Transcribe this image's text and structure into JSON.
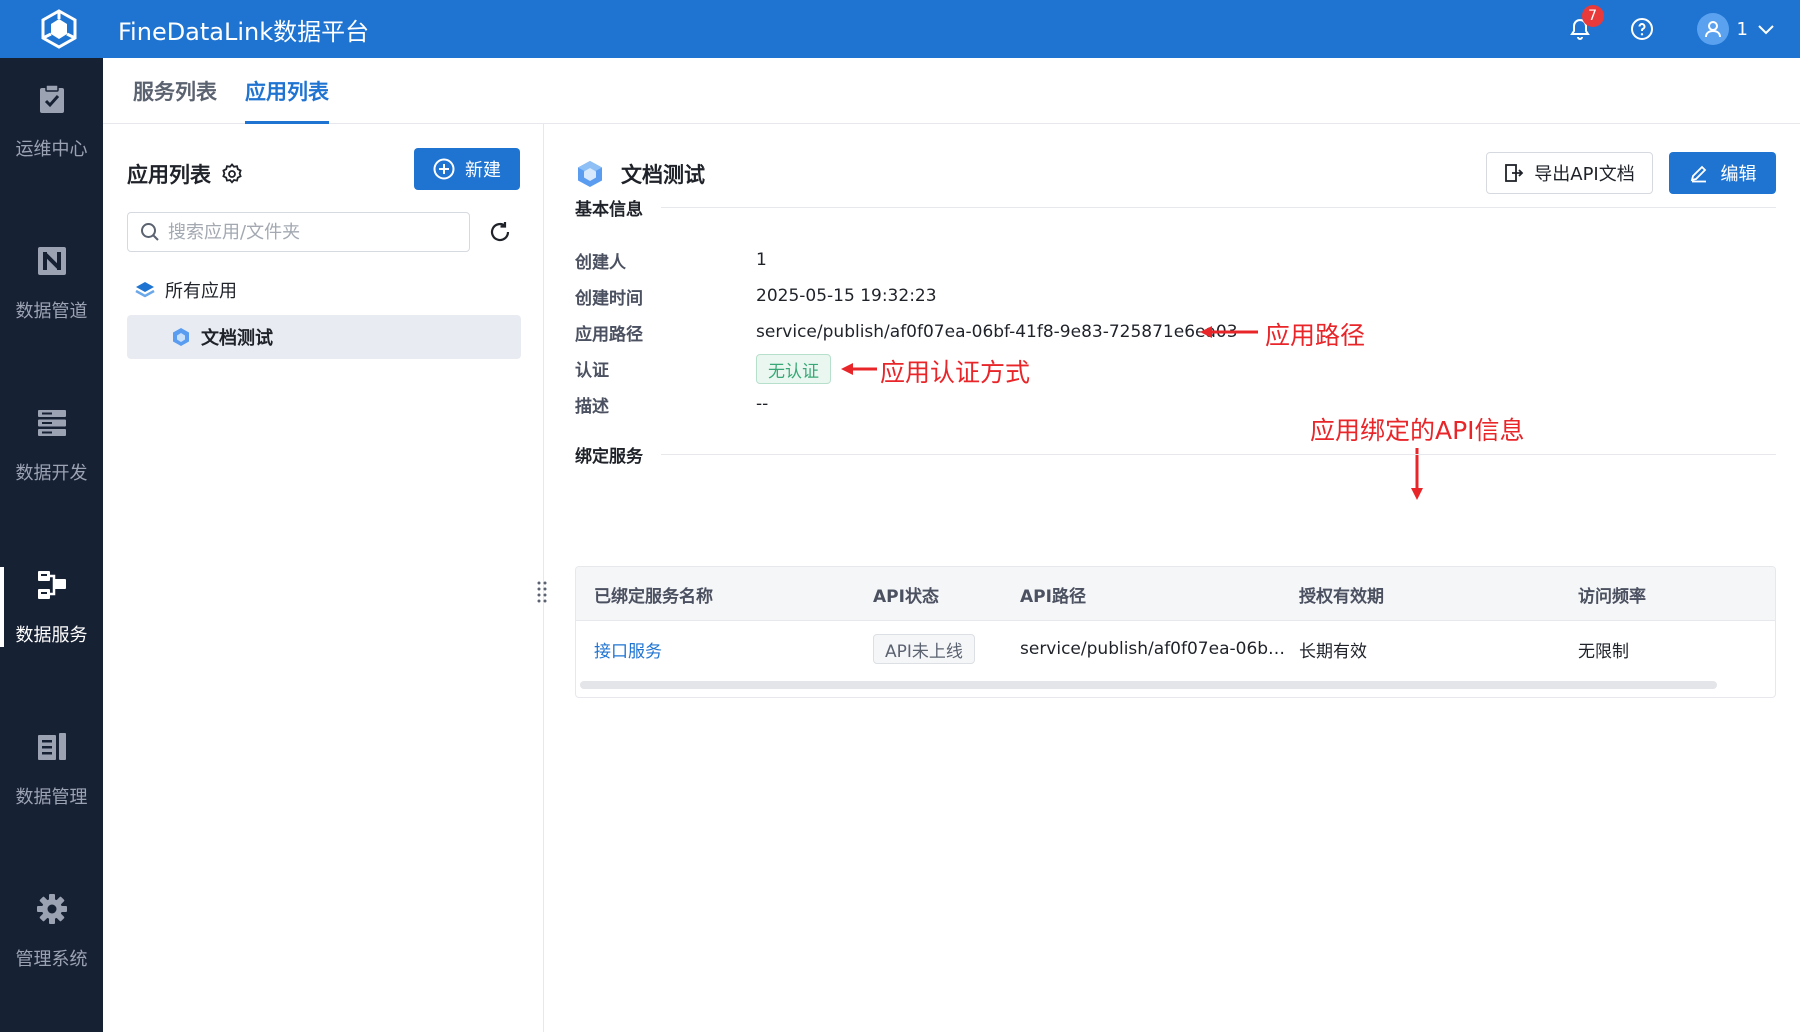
{
  "header": {
    "app_title": "FineDataLink数据平台",
    "notification_count": "7",
    "user_name": "1"
  },
  "leftnav": {
    "items": [
      {
        "label": "运维中心",
        "icon": "clipboard-check-icon"
      },
      {
        "label": "数据管道",
        "icon": "pipeline-icon"
      },
      {
        "label": "数据开发",
        "icon": "server-stack-icon"
      },
      {
        "label": "数据服务",
        "icon": "data-service-icon",
        "active": true
      },
      {
        "label": "数据管理",
        "icon": "data-manage-icon"
      },
      {
        "label": "管理系统",
        "icon": "gear-icon"
      }
    ]
  },
  "tabs": [
    {
      "label": "服务列表"
    },
    {
      "label": "应用列表",
      "active": true
    }
  ],
  "sidebar": {
    "title": "应用列表",
    "new_label": "新建",
    "search_placeholder": "搜索应用/文件夹",
    "tree_root": "所有应用",
    "tree_child": "文档测试"
  },
  "detail": {
    "title": "文档测试",
    "export_label": "导出API文档",
    "edit_label": "编辑",
    "section_basic": "基本信息",
    "fields": {
      "creator_label": "创建人",
      "creator_value": "1",
      "created_label": "创建时间",
      "created_value": "2025-05-15 19:32:23",
      "path_label": "应用路径",
      "path_value": "service/publish/af0f07ea-06bf-41f8-9e83-725871e6ea03",
      "auth_label": "认证",
      "auth_value": "无认证",
      "desc_label": "描述",
      "desc_value": "--"
    },
    "section_bind": "绑定服务",
    "table": {
      "columns": [
        "已绑定服务名称",
        "API状态",
        "API路径",
        "授权有效期",
        "访问频率"
      ],
      "rows": [
        {
          "name": "接口服务",
          "status": "API未上线",
          "path": "service/publish/af0f07ea-06b…",
          "validity": "长期有效",
          "frequency": "无限制"
        }
      ]
    }
  },
  "annotations": {
    "path": "应用路径",
    "auth": "应用认证方式",
    "bound_api": "应用绑定的API信息"
  },
  "colors": {
    "primary": "#1f74d2",
    "nav_bg": "#172134",
    "annotation": "#e8262a",
    "auth_tag": "#3aa876",
    "badge": "#e83a3a"
  }
}
